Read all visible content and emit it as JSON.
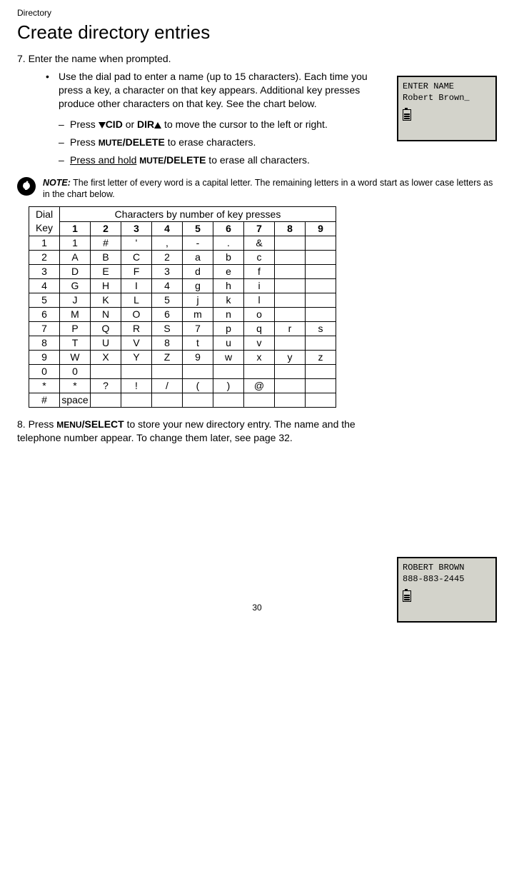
{
  "breadcrumb": "Directory",
  "heading": "Create directory entries",
  "step7": {
    "prompt": "7. Enter the name when prompted.",
    "bullet": "Use the dial pad to enter a name (up to 15 characters). Each time you press a key, a character on that key appears. Additional key presses produce other characters on that key. See the chart below.",
    "sub1_a": "Press ",
    "sub1_cid": "CID",
    "sub1_or": " or ",
    "sub1_dir": "DIR",
    "sub1_rest": " to move the cursor to the left or right.",
    "sub2_a": "Press ",
    "sub2_mute": "MUTE",
    "sub2_delete": "/DELETE",
    "sub2_rest": " to erase characters.",
    "sub3_a": "Press and hold",
    "sub3_mute": "MUTE",
    "sub3_delete": "/DELETE",
    "sub3_rest": " to erase all characters."
  },
  "note": {
    "label": "NOTE:",
    "text": " The first letter of every word is a capital letter. The remaining letters in a word start as lower case letters as in the chart below."
  },
  "screen1": {
    "line1": "ENTER NAME",
    "line2": "Robert Brown_"
  },
  "screen2": {
    "line1": "ROBERT BROWN",
    "line2": "888-883-2445"
  },
  "step8": {
    "a": "8. Press ",
    "menu": "MENU",
    "select": "/SELECT",
    "rest": " to store your new directory entry. The name and the telephone number appear. To change them later, see page 32."
  },
  "pageNumber": "30",
  "chart_data": {
    "type": "table",
    "title": "Characters by number of key presses",
    "corner_label_line1": "Dial",
    "corner_label_line2": "Key",
    "press_headers": [
      "1",
      "2",
      "3",
      "4",
      "5",
      "6",
      "7",
      "8",
      "9"
    ],
    "rows": [
      {
        "key": "1",
        "cells": [
          "1",
          "#",
          "'",
          ",",
          "-",
          ".",
          "&",
          "",
          ""
        ]
      },
      {
        "key": "2",
        "cells": [
          "A",
          "B",
          "C",
          "2",
          "a",
          "b",
          "c",
          "",
          ""
        ]
      },
      {
        "key": "3",
        "cells": [
          "D",
          "E",
          "F",
          "3",
          "d",
          "e",
          "f",
          "",
          ""
        ]
      },
      {
        "key": "4",
        "cells": [
          "G",
          "H",
          "I",
          "4",
          "g",
          "h",
          "i",
          "",
          ""
        ]
      },
      {
        "key": "5",
        "cells": [
          "J",
          "K",
          "L",
          "5",
          "j",
          "k",
          "l",
          "",
          ""
        ]
      },
      {
        "key": "6",
        "cells": [
          "M",
          "N",
          "O",
          "6",
          "m",
          "n",
          "o",
          "",
          ""
        ]
      },
      {
        "key": "7",
        "cells": [
          "P",
          "Q",
          "R",
          "S",
          "7",
          "p",
          "q",
          "r",
          "s"
        ]
      },
      {
        "key": "8",
        "cells": [
          "T",
          "U",
          "V",
          "8",
          "t",
          "u",
          "v",
          "",
          ""
        ]
      },
      {
        "key": "9",
        "cells": [
          "W",
          "X",
          "Y",
          "Z",
          "9",
          "w",
          "x",
          "y",
          "z"
        ]
      },
      {
        "key": "0",
        "cells": [
          "0",
          "",
          "",
          "",
          "",
          "",
          "",
          "",
          ""
        ]
      },
      {
        "key": "*",
        "cells": [
          "*",
          "?",
          "!",
          "/",
          "(",
          ")",
          "@",
          "",
          ""
        ]
      },
      {
        "key": "#",
        "cells": [
          "space",
          "",
          "",
          "",
          "",
          "",
          "",
          "",
          ""
        ]
      }
    ]
  }
}
